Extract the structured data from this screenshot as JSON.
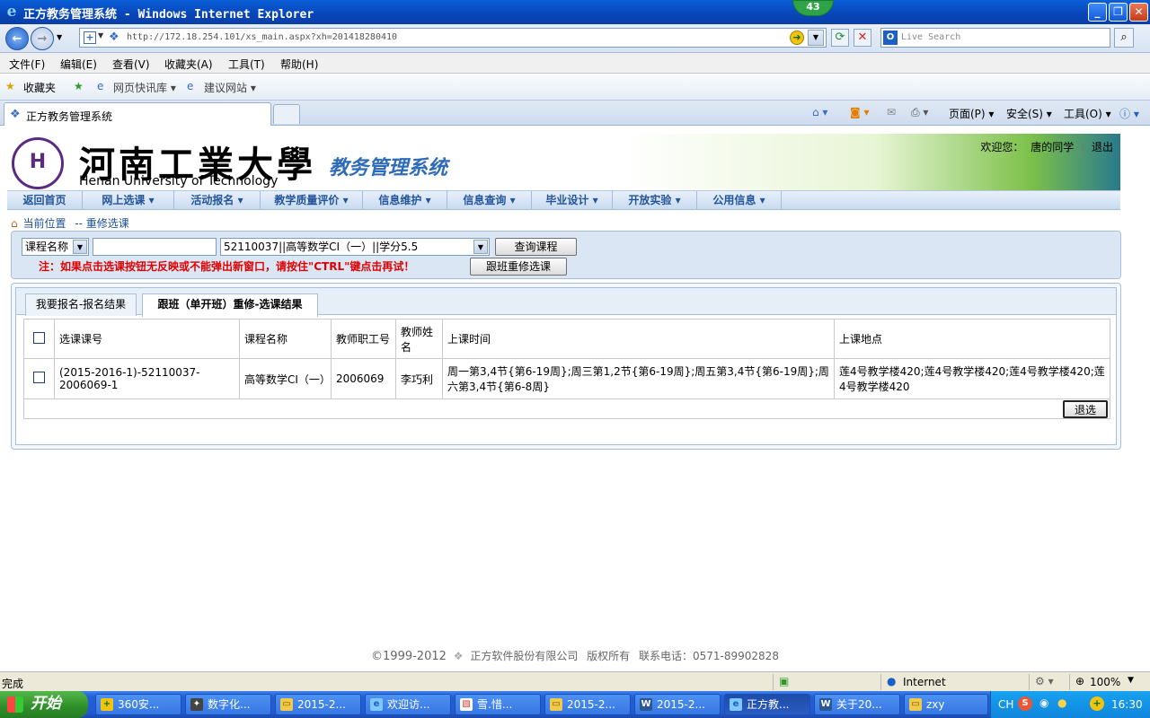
{
  "window": {
    "title": "正方教务管理系统 - Windows Internet Explorer",
    "badge": "43"
  },
  "addressbar": {
    "url": "http://172.18.254.101/xs_main.aspx?xh=201418280410",
    "search_placeholder": "Live Search"
  },
  "menu": [
    "文件(F)",
    "编辑(E)",
    "查看(V)",
    "收藏夹(A)",
    "工具(T)",
    "帮助(H)"
  ],
  "favorites": {
    "label": "收藏夹",
    "items": [
      "网页快讯库 ▾",
      "建议网站 ▾"
    ]
  },
  "tab": {
    "title": "正方教务管理系统"
  },
  "commandbar": {
    "page": "页面(P) ▾",
    "safety": "安全(S) ▾",
    "tools": "工具(O) ▾"
  },
  "header": {
    "school_cn": "河南工業大學",
    "school_en": "Henan University of Technology",
    "system": "教务管理系统",
    "welcome": "欢迎您：",
    "user": "唐的同学",
    "logout": "退出"
  },
  "nav": [
    "返回首页",
    "网上选课 ▾",
    "活动报名 ▾",
    "教学质量评价 ▾",
    "信息维护 ▾",
    "信息查询 ▾",
    "毕业设计 ▾",
    "开放实验 ▾",
    "公用信息 ▾"
  ],
  "breadcrumb": {
    "label": "当前位置",
    "path": "-- 重修选课"
  },
  "filter": {
    "field_select": "课程名称",
    "course_select": "52110037||高等数学CⅠ（一）||学分5.5",
    "query_button": "查询课程",
    "warning": "注：如果点击选课按钮无反映或不能弹出新窗口，请按住\"CTRL\"键点击再试！",
    "retake_button": "跟班重修选课"
  },
  "result": {
    "tabs": [
      "我要报名-报名结果",
      "跟班（单开班）重修-选课结果"
    ],
    "columns": [
      "选课课号",
      "课程名称",
      "教师职工号",
      "教师姓名",
      "上课时间",
      "上课地点"
    ],
    "rows": [
      {
        "code": "(2015-2016-1)-52110037-2006069-1",
        "course": "高等数学CⅠ（一）",
        "teacher_id": "2006069",
        "teacher": "李巧利",
        "time": "周一第3,4节{第6-19周};周三第1,2节{第6-19周};周五第3,4节{第6-19周};周六第3,4节{第6-8周}",
        "place": "莲4号教学楼420;莲4号教学楼420;莲4号教学楼420;莲4号教学楼420"
      }
    ],
    "drop_button": "退选"
  },
  "footer": {
    "copyright": "©1999-2012",
    "company": "正方软件股份有限公司",
    "rights": "版权所有",
    "phone": "联系电话：0571-89902828"
  },
  "status": {
    "text": "完成",
    "zone": "Internet",
    "zoom": "100%"
  },
  "taskbar": {
    "start": "开始",
    "tasks": [
      "360安...",
      "数字化...",
      "2015-2...",
      "欢迎访...",
      "雪.惜...",
      "2015-2...",
      "2015-2...",
      "正方教...",
      "关于20...",
      "zxy"
    ],
    "lang": "CH",
    "time": "16:30"
  }
}
